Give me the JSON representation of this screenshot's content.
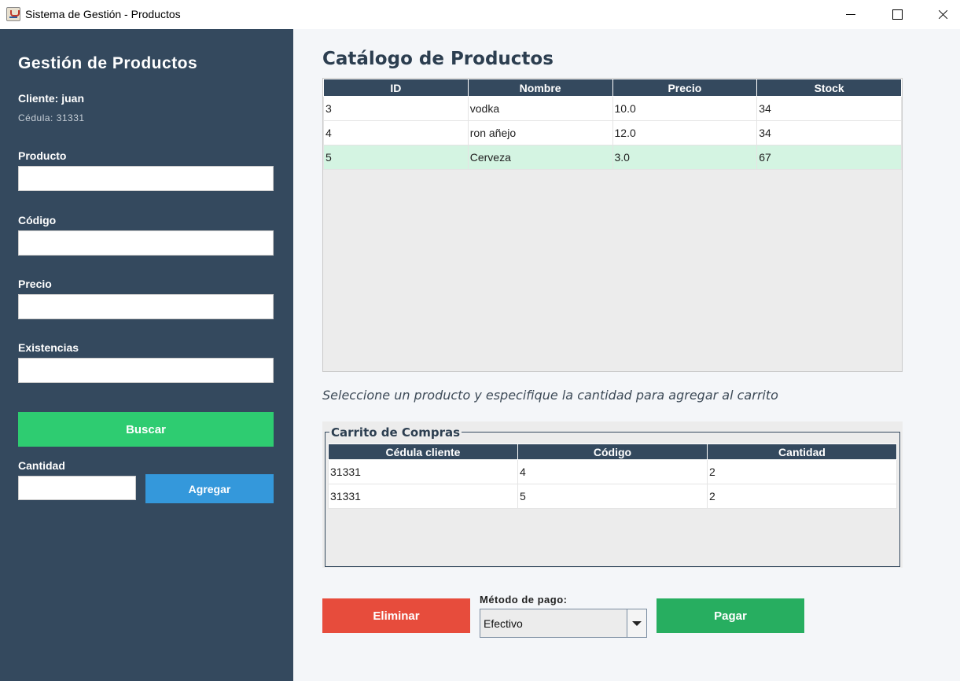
{
  "window": {
    "title": "Sistema de Gestión - Productos"
  },
  "sidebar": {
    "title": "Gestión de Productos",
    "client": "Cliente: juan",
    "cedula": "Cédula: 31331",
    "fields": {
      "producto": {
        "label": "Producto",
        "value": ""
      },
      "codigo": {
        "label": "Código",
        "value": ""
      },
      "precio": {
        "label": "Precio",
        "value": ""
      },
      "existencias": {
        "label": "Existencias",
        "value": ""
      }
    },
    "buscar_label": "Buscar",
    "cantidad_label": "Cantidad",
    "cantidad_value": "",
    "agregar_label": "Agregar"
  },
  "main": {
    "title": "Catálogo de Productos",
    "catalog": {
      "headers": [
        "ID",
        "Nombre",
        "Precio",
        "Stock"
      ],
      "rows": [
        [
          "3",
          "vodka",
          "10.0",
          "34"
        ],
        [
          "4",
          "ron añejo",
          "12.0",
          "34"
        ],
        [
          "5",
          "Cerveza",
          "3.0",
          "67"
        ]
      ],
      "selected_row": 2
    },
    "hint": "Seleccione un producto y especifique la cantidad para agregar al carrito",
    "cart": {
      "title": "Carrito de Compras",
      "headers": [
        "Cédula cliente",
        "Código",
        "Cantidad"
      ],
      "rows": [
        [
          "31331",
          "4",
          "2"
        ],
        [
          "31331",
          "5",
          "2"
        ]
      ]
    },
    "eliminar_label": "Eliminar",
    "payment": {
      "label": "Método de pago:",
      "selected": "Efectivo"
    },
    "pagar_label": "Pagar"
  },
  "colors": {
    "sidebar": "#34495e",
    "buscar": "#2ecc71",
    "agregar": "#3498db",
    "eliminar": "#e74c3c",
    "pagar": "#27ae60",
    "selected_row": "#d4f4e2"
  }
}
